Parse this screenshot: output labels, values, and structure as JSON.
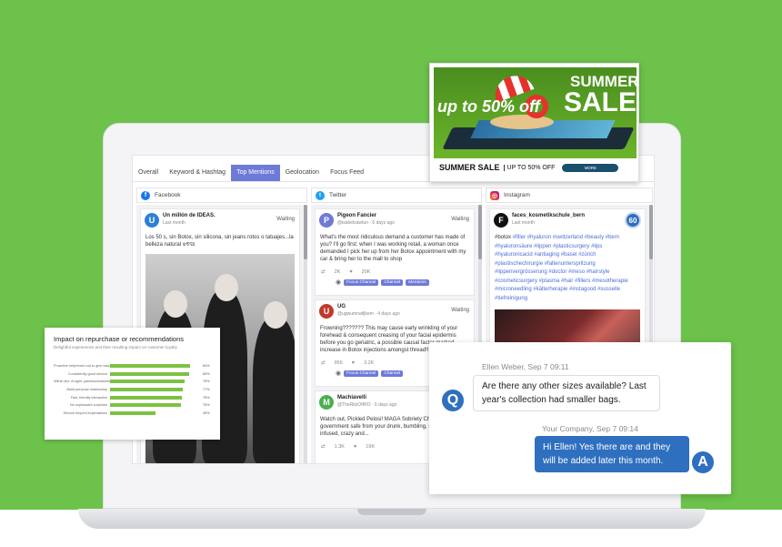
{
  "tabs": [
    "Overall",
    "Keyword & Hashtag",
    "Top Mentions",
    "Geolocation",
    "Focus Feed"
  ],
  "active_tab": "Top Mentions",
  "columns": {
    "facebook": {
      "title": "Facebook",
      "post": {
        "avatar": "U",
        "name": "Un millón de IDEAS.",
        "time": "Last month",
        "status": "Waiting",
        "text": "Los 50 s, sin Botox, sin silicona, sin jeans rotos o tatuajes...la belleza natural ଝଵସା"
      }
    },
    "twitter": {
      "title": "Twitter",
      "posts": [
        {
          "avatar": "P",
          "name": "Pigeon Fancier",
          "meta": "@isabelzawtun · 5 days ago",
          "status": "Waiting",
          "text": "What's the most ridiculous demand a customer has made of you? I'll go first: when I was working retail, a woman once demanded I pick her up from her Botox appointment with my car & bring her to the mall to shop",
          "retweets": "2K",
          "likes": "20K"
        },
        {
          "avatar": "U",
          "name": "UG",
          "meta": "@ugwumnafijkem · 4 days ago",
          "status": "Waiting",
          "text": "Frowning??????? This may cause early wrinkling of your forehead & consequent creasing of your facial epidermis before you go geriatric, a possible causal factor marked increase in Botox injections amongst thread!!!!!!",
          "retweets": "956",
          "likes": "3.2K"
        },
        {
          "avatar": "M",
          "name": "Machiavelli",
          "meta": "@TheRitzOfRIO · 6 days ago",
          "text": "Watch out, Pickled Pelosi! MAGA Sobriety Check... keep the government safe from your drunk, bumbling, stumbling, botox infused, crazy and...",
          "retweets": "1.3K",
          "likes": "19K"
        }
      ],
      "chips": [
        "Focus Channel",
        "Channel",
        "Mentions"
      ]
    },
    "instagram": {
      "title": "Instagram",
      "post": {
        "avatar": "F",
        "name": "faces_kosmetikschule_bern",
        "time": "Last month",
        "badge": "60",
        "text_plain_1": "#botox ",
        "text_plain_2": "#hyaluron",
        "text": "#filler #hyaluron #switzerland #beauty #bern #hyaluronsäure #lippen #plasticsurgery #lips #hyaluronicacid #antiaging #basel #zürich #plastischechirurgie #faltenunterspritzung #lippenvergrösserung #doctor #meso #hairstyle #cosmeticsurgery #plasma #hair #fillers #mesotherapie #microneedling #kälterherapie #instagood #susselle #tiefreinigung"
      }
    }
  },
  "sale_banner": {
    "upto": "up to 50% off",
    "summer": "SUMMER",
    "sale": "SALE",
    "bottom_left": "SUMMER SALE",
    "bottom_right": "UP TO 50% OFF",
    "button": "MORE"
  },
  "survey": {
    "title": "Impact on repurchase or recommendations",
    "subtitle": "Delightful experiences and their resulting impact on customer loyalty",
    "rows": [
      {
        "label": "Proactive help/reach out to give value out of your product",
        "value": 0.88,
        "pct": "84%"
      },
      {
        "label": "Consistently good service",
        "value": 0.87,
        "pct": "83%"
      },
      {
        "label": "Within line of sight, painless/seamless/hassle-free",
        "value": 0.82,
        "pct": "79%"
      },
      {
        "label": "Build personal relationship",
        "value": 0.8,
        "pct": "77%"
      },
      {
        "label": "Fast, friendly interaction",
        "value": 0.79,
        "pct": "76%"
      },
      {
        "label": "No unpleasant surprises",
        "value": 0.78,
        "pct": "75%"
      },
      {
        "label": "Service beyond expectations",
        "value": 0.5,
        "pct": "49%"
      }
    ]
  },
  "chat": {
    "incoming_meta": "Ellen Weber, Sep 7 09:11",
    "incoming_text": "Are there any other sizes available? Last year's collection had smaller bags.",
    "outgoing_meta": "Your Company, Sep 7 09:14",
    "outgoing_text": "Hi Ellen! Yes there are and they will be added later this month.",
    "q_label": "Q",
    "a_label": "A"
  },
  "colors": {
    "background": "#6cc24a",
    "accent": "#6d7ad8",
    "chat_blue": "#2f6fbf",
    "bar_green": "#7dc142"
  }
}
